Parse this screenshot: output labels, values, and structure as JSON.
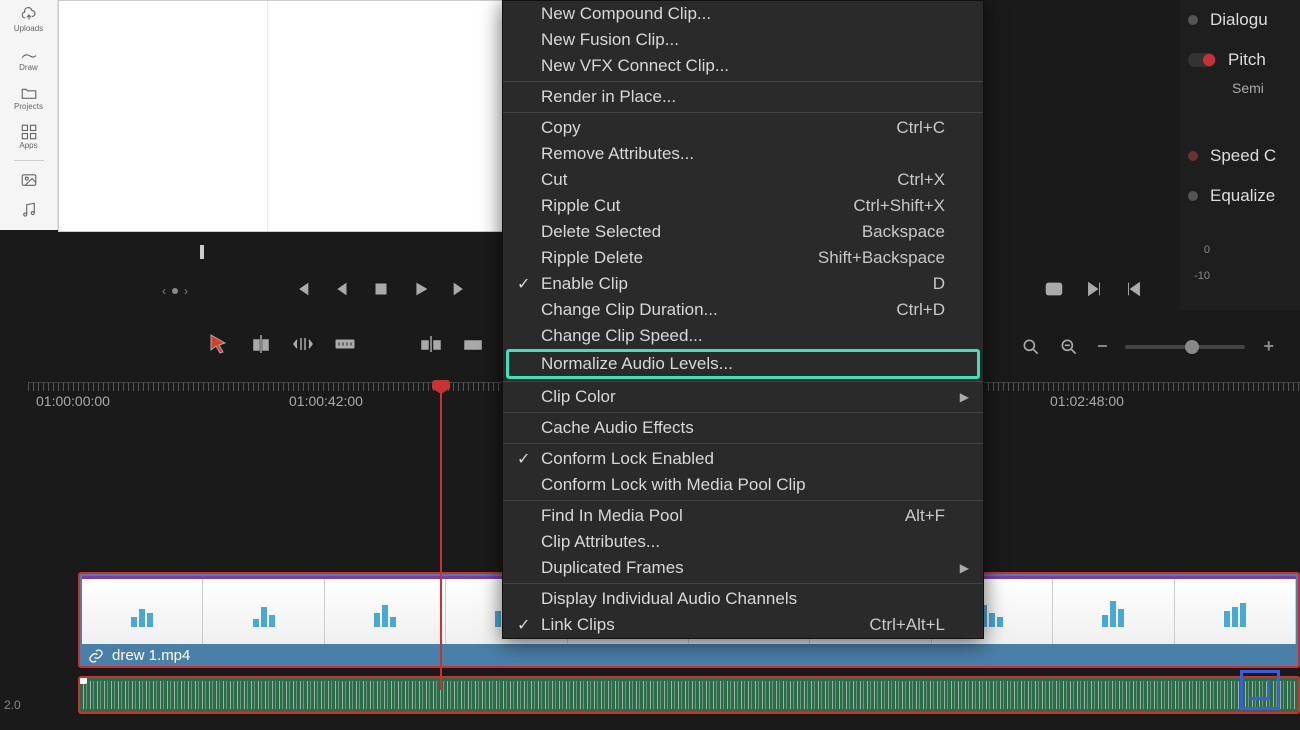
{
  "sidebar": {
    "items": [
      {
        "label": "Uploads",
        "icon": "uploads"
      },
      {
        "label": "Draw",
        "icon": "draw"
      },
      {
        "label": "Projects",
        "icon": "projects"
      },
      {
        "label": "Apps",
        "icon": "apps"
      },
      {
        "label": "Photos",
        "icon": "photos"
      },
      {
        "label": "Audio",
        "icon": "audio"
      }
    ]
  },
  "ruler": {
    "labels": [
      {
        "pos": 8,
        "text": "01:00:00:00"
      },
      {
        "pos": 261,
        "text": "01:00:42:00"
      },
      {
        "pos": 1022,
        "text": "01:02:48:00"
      }
    ]
  },
  "clip": {
    "name": "drew 1.mp4"
  },
  "left_scale": "2.0",
  "context_menu": {
    "groups": [
      [
        {
          "label": "New Compound Clip...",
          "shortcut": ""
        },
        {
          "label": "New Fusion Clip...",
          "shortcut": ""
        },
        {
          "label": "New VFX Connect Clip...",
          "shortcut": ""
        }
      ],
      [
        {
          "label": "Render in Place...",
          "shortcut": ""
        }
      ],
      [
        {
          "label": "Copy",
          "shortcut": "Ctrl+C"
        },
        {
          "label": "Remove Attributes...",
          "shortcut": ""
        },
        {
          "label": "Cut",
          "shortcut": "Ctrl+X"
        },
        {
          "label": "Ripple Cut",
          "shortcut": "Ctrl+Shift+X"
        },
        {
          "label": "Delete Selected",
          "shortcut": "Backspace"
        },
        {
          "label": "Ripple Delete",
          "shortcut": "Shift+Backspace"
        },
        {
          "label": "Enable Clip",
          "shortcut": "D",
          "checked": true
        },
        {
          "label": "Change Clip Duration...",
          "shortcut": "Ctrl+D"
        },
        {
          "label": "Change Clip Speed...",
          "shortcut": ""
        },
        {
          "label": "Normalize Audio Levels...",
          "shortcut": "",
          "highlighted": true
        }
      ],
      [
        {
          "label": "Clip Color",
          "shortcut": "",
          "submenu": true
        }
      ],
      [
        {
          "label": "Cache Audio Effects",
          "shortcut": ""
        }
      ],
      [
        {
          "label": "Conform Lock Enabled",
          "shortcut": "",
          "checked": true
        },
        {
          "label": "Conform Lock with Media Pool Clip",
          "shortcut": ""
        }
      ],
      [
        {
          "label": "Find In Media Pool",
          "shortcut": "Alt+F"
        },
        {
          "label": "Clip Attributes...",
          "shortcut": ""
        },
        {
          "label": "Duplicated Frames",
          "shortcut": "",
          "submenu": true
        }
      ],
      [
        {
          "label": "Display Individual Audio Channels",
          "shortcut": ""
        },
        {
          "label": "Link Clips",
          "shortcut": "Ctrl+Alt+L",
          "checked": true
        }
      ]
    ]
  },
  "inspector": {
    "items": [
      {
        "label": "Dialogu",
        "dot": "grey"
      },
      {
        "label": "Pitch",
        "dot": "red",
        "toggle": true,
        "sub": "Semi"
      },
      {
        "label": "Speed C",
        "dot": "dimred"
      },
      {
        "label": "Equalize",
        "dot": "grey"
      }
    ],
    "db": [
      "0",
      "-10"
    ]
  },
  "zoom": {
    "minus": "−",
    "plus": "+"
  }
}
